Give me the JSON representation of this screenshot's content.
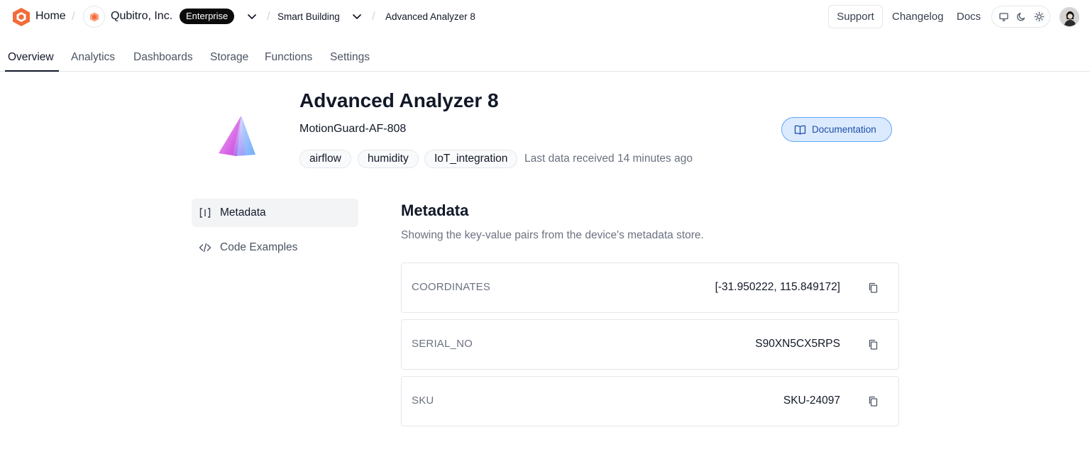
{
  "topbar": {
    "home_label": "Home",
    "org_name": "Qubitro, Inc.",
    "plan_badge": "Enterprise",
    "project": "Smart Building",
    "current_device": "Advanced Analyzer 8",
    "support_label": "Support",
    "changelog_label": "Changelog",
    "docs_label": "Docs",
    "theme_modes": [
      "monitor-icon",
      "moon-icon",
      "sun-icon"
    ],
    "active_theme": "sun-icon"
  },
  "tabs": [
    {
      "label": "Overview",
      "active": true
    },
    {
      "label": "Analytics",
      "active": false
    },
    {
      "label": "Dashboards",
      "active": false
    },
    {
      "label": "Storage",
      "active": false
    },
    {
      "label": "Functions",
      "active": false
    },
    {
      "label": "Settings",
      "active": false
    }
  ],
  "device": {
    "title": "Advanced Analyzer 8",
    "model": "MotionGuard-AF-808",
    "tags": [
      "airflow",
      "humidity",
      "IoT_integration"
    ],
    "last_data": "Last data received 14 minutes ago",
    "documentation_label": "Documentation"
  },
  "sidenav": [
    {
      "label": "Metadata",
      "icon": "brackets-icon",
      "active": true
    },
    {
      "label": "Code Examples",
      "icon": "code-icon",
      "active": false
    }
  ],
  "metadata": {
    "title": "Metadata",
    "description": "Showing the key-value pairs from the device's metadata store.",
    "rows": [
      {
        "key": "COORDINATES",
        "value": "[-31.950222, 115.849172]"
      },
      {
        "key": "SERIAL_NO",
        "value": "S90XN5CX5RPS"
      },
      {
        "key": "SKU",
        "value": "SKU-24097"
      }
    ]
  },
  "colors": {
    "brand": "#f26b3a",
    "accent_button_bg": "#dbeafe",
    "accent_button_border": "#60a5fa",
    "accent_button_text": "#1e4ea8"
  }
}
